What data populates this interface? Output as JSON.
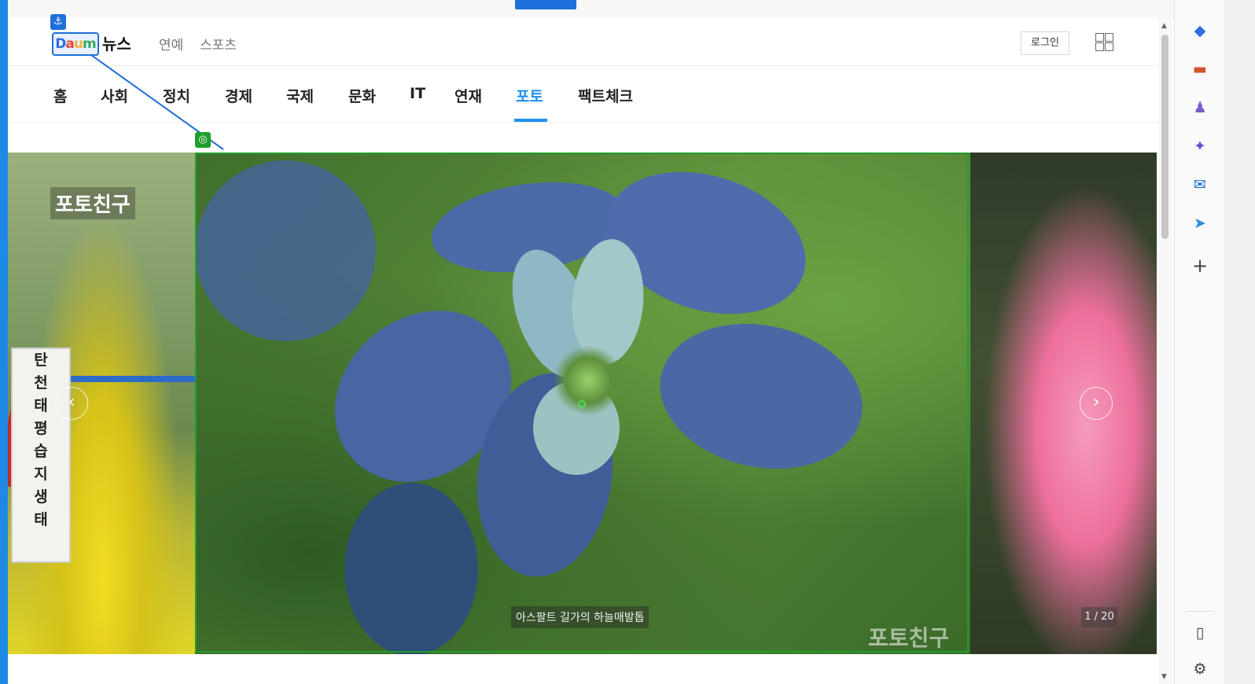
{
  "header": {
    "brand": "뉴스",
    "links": [
      "연예",
      "스포츠"
    ],
    "login_label": "로그인"
  },
  "nav": {
    "items": [
      "홈",
      "사회",
      "정치",
      "경제",
      "국제",
      "문화",
      "IT",
      "연재",
      "포토",
      "팩트체크"
    ],
    "active": "포토"
  },
  "carousel": {
    "section_label": "포토친구",
    "caption": "아스팔트 길가의 하늘매발톱",
    "counter": "1 / 20",
    "watermark": "포토친구",
    "left_sign_text": [
      "탄",
      "천",
      "태",
      "평",
      "습",
      "지",
      "생",
      "태"
    ]
  },
  "colors": {
    "accent_blue": "#1e8ff5",
    "selection_green": "#1e9e2a",
    "annotation_blue": "#1e6fd9"
  },
  "icons": {
    "anchor": "anchor-icon",
    "target": "target-icon",
    "grid": "grid-menu-icon",
    "prev": "chevron-left-icon",
    "next": "chevron-right-icon"
  }
}
